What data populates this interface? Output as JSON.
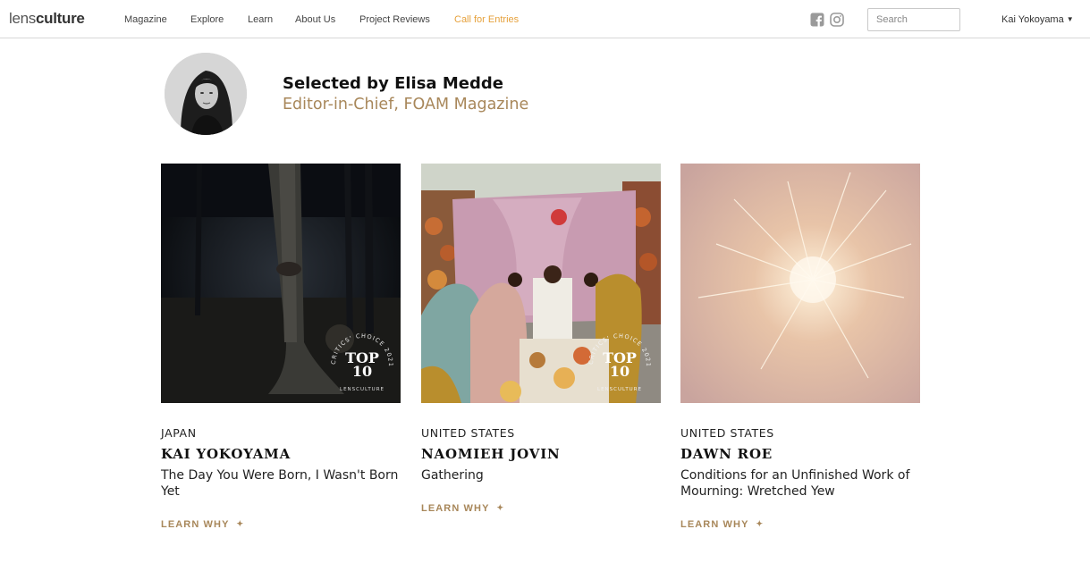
{
  "header": {
    "logo_light": "lens",
    "logo_bold": "culture",
    "nav": [
      "Magazine",
      "Explore",
      "Learn",
      "About Us",
      "Project Reviews",
      "Call for Entries"
    ],
    "search_placeholder": "Search",
    "user_name": "Kai Yokoyama",
    "accent_color": "#e6a13c"
  },
  "curator": {
    "name": "Selected by Elisa Medde",
    "role": "Editor-in-Chief, FOAM Magazine"
  },
  "badge": {
    "line1": "TOP",
    "line2": "10",
    "ring_top": "CRITICS' CHOICE 2021",
    "ring_bottom": "LENSCULTURE"
  },
  "cards": [
    {
      "country": "JAPAN",
      "artist": "KAI YOKOYAMA",
      "title": "The Day You Were Born, I Wasn't Born Yet",
      "learn_label": "LEARN WHY",
      "top10": true
    },
    {
      "country": "UNITED STATES",
      "artist": "NAOMIEH JOVIN",
      "title": "Gathering",
      "learn_label": "LEARN WHY",
      "top10": true
    },
    {
      "country": "UNITED STATES",
      "artist": "DAWN ROE",
      "title": "Conditions for an Unfinished Work of Mourning: Wretched Yew",
      "learn_label": "LEARN WHY",
      "top10": false
    }
  ],
  "colors": {
    "gold": "#a8875a",
    "divider": "#d8d8d8"
  }
}
